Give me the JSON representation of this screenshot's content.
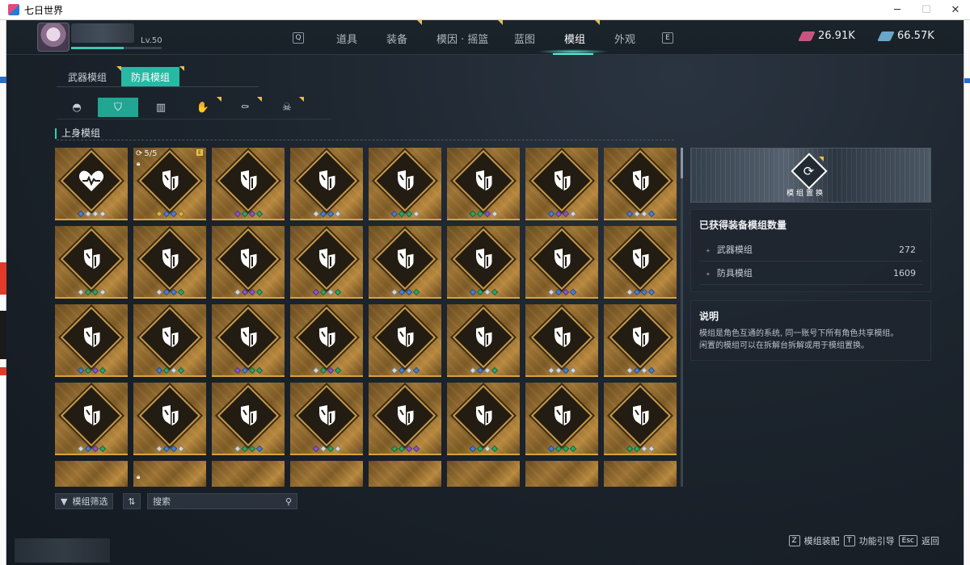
{
  "window": {
    "title": "七日世界",
    "buttons": [
      "─",
      "☐",
      "✕"
    ]
  },
  "player": {
    "level": "Lv.50"
  },
  "nav": {
    "left_key": "Q",
    "right_key": "E",
    "tabs": [
      "道具",
      "装备",
      "模因 · 摇篮",
      "蓝图",
      "模组",
      "外观"
    ],
    "active_tab": "模组"
  },
  "currency": [
    {
      "value": "26.91K",
      "color": "#c9557e",
      "icon": "pink-gem-icon"
    },
    {
      "value": "66.57K",
      "color": "#6aa6c8",
      "icon": "blue-gem-icon"
    }
  ],
  "category_tabs": [
    "武器模组",
    "防具模组"
  ],
  "active_category": "防具模组",
  "slot_icons": [
    "helmet-icon",
    "upper-body-icon",
    "legs-icon",
    "gloves-icon",
    "boots-icon",
    "mask-icon"
  ],
  "section_title": "上身模组",
  "colors": {
    "teal": "#27b9a3",
    "gold": "#d9a23a",
    "dot_colors": {
      "b": "#4a7fd4",
      "g": "#2fa566",
      "p": "#8a57c9",
      "w": "#d8d8d8",
      "y": "#e2b23b"
    }
  },
  "grid": {
    "rows": [
      [
        {
          "icon": "heart-icon",
          "dots": "bwww"
        },
        {
          "icon": "shield-icon",
          "dots": "ybby",
          "count": "5/5",
          "locked": true,
          "flag": "E"
        },
        {
          "icon": "shield-icon",
          "dots": "pgpg"
        },
        {
          "icon": "shield-icon",
          "dots": "wbbw"
        },
        {
          "icon": "shield-icon",
          "dots": "bggw"
        },
        {
          "icon": "shield-icon",
          "dots": "ggpw"
        },
        {
          "icon": "shield-icon",
          "dots": "bppw"
        },
        {
          "icon": "shield-icon",
          "dots": "bwwb"
        }
      ],
      [
        {
          "icon": "shield-icon",
          "dots": "wggw"
        },
        {
          "icon": "shield-icon",
          "dots": "wbbg"
        },
        {
          "icon": "shield-icon",
          "dots": "wppg"
        },
        {
          "icon": "shield-icon",
          "dots": "pgwg"
        },
        {
          "icon": "shield-icon",
          "dots": "wbbg"
        },
        {
          "icon": "shield-icon",
          "dots": "bgwg"
        },
        {
          "icon": "shield-icon",
          "dots": "wbpb"
        },
        {
          "icon": "shield-icon",
          "dots": "wbbb"
        }
      ],
      [
        {
          "icon": "shield-icon",
          "dots": "bgpg"
        },
        {
          "icon": "shield-icon",
          "dots": "bgwg"
        },
        {
          "icon": "shield-icon",
          "dots": "pbgg"
        },
        {
          "icon": "shield-icon",
          "dots": "wgpg"
        },
        {
          "icon": "shield-icon",
          "dots": "wbwb"
        },
        {
          "icon": "shield-icon",
          "dots": "wbwg"
        },
        {
          "icon": "shield-icon",
          "dots": "wwbw"
        },
        {
          "icon": "shield-icon",
          "dots": "wbwb"
        }
      ],
      [
        {
          "icon": "shield-icon",
          "dots": "wbpg"
        },
        {
          "icon": "shield-icon",
          "dots": "wbbw"
        },
        {
          "icon": "shield-icon",
          "dots": "wggb"
        },
        {
          "icon": "shield-icon",
          "dots": "pwgw"
        },
        {
          "icon": "shield-icon",
          "dots": "ggpp"
        },
        {
          "icon": "shield-icon",
          "dots": "bgwg"
        },
        {
          "icon": "shield-icon",
          "dots": "bggg"
        },
        {
          "icon": "shield-icon",
          "dots": "ggww"
        }
      ],
      [
        {
          "icon": "shield-icon",
          "dots": ""
        },
        {
          "icon": "shield-icon",
          "dots": "",
          "locked": true
        },
        {
          "icon": "shield-icon",
          "dots": ""
        },
        {
          "icon": "shield-icon",
          "dots": ""
        },
        {
          "icon": "shield-icon",
          "dots": ""
        },
        {
          "icon": "shield-icon",
          "dots": ""
        },
        {
          "icon": "shield-icon",
          "dots": ""
        },
        {
          "icon": "shield-icon",
          "dots": ""
        }
      ]
    ]
  },
  "toolbar": {
    "filter_label": "模组筛选",
    "sort_icon": "sort-icon",
    "search_placeholder": "搜索"
  },
  "panel": {
    "hero_label": "模组置换",
    "owned_title": "已获得装备模组数量",
    "stats": [
      {
        "label": "武器模组",
        "value": "272"
      },
      {
        "label": "防具模组",
        "value": "1609"
      }
    ],
    "desc_title": "说明",
    "desc_lines": [
      "模组是角色互通的系统, 同一账号下所有角色共享模组。",
      "闲置的模组可以在拆解台拆解或用于模组置换。"
    ]
  },
  "footer": [
    {
      "key": "Z",
      "label": "模组装配"
    },
    {
      "key": "T",
      "label": "功能引导"
    },
    {
      "key": "Esc",
      "label": "返回"
    }
  ]
}
